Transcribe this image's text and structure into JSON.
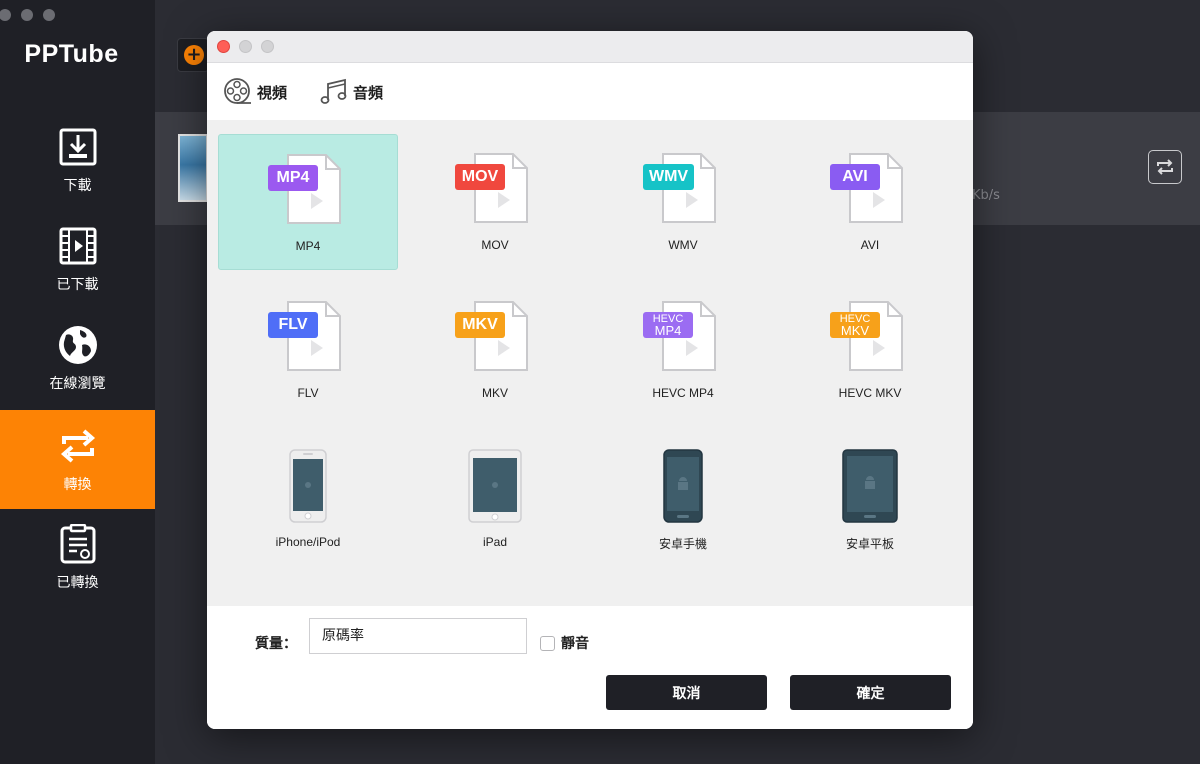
{
  "app": {
    "title": "PPTube"
  },
  "sidebar": {
    "items": [
      {
        "label": "下載",
        "icon": "download-icon"
      },
      {
        "label": "已下載",
        "icon": "film-icon"
      },
      {
        "label": "在線瀏覽",
        "icon": "globe-icon"
      },
      {
        "label": "轉換",
        "icon": "convert-icon",
        "active": true
      },
      {
        "label": "已轉換",
        "icon": "converted-list-icon"
      }
    ],
    "active_color": "#fd8305"
  },
  "background": {
    "speed_fragment": "Kb/s"
  },
  "dialog": {
    "tabs": [
      {
        "label": "視頻",
        "icon": "film-reel-icon",
        "active": true
      },
      {
        "label": "音頻",
        "icon": "music-note-icon"
      }
    ],
    "formats": [
      {
        "label": "MP4",
        "badge": "MP4",
        "badge_color": "#9b59f0",
        "selected": true
      },
      {
        "label": "MOV",
        "badge": "MOV",
        "badge_color": "#f0483e"
      },
      {
        "label": "WMV",
        "badge": "WMV",
        "badge_color": "#16c3c7"
      },
      {
        "label": "AVI",
        "badge": "AVI",
        "badge_color": "#8a5cf2"
      },
      {
        "label": "FLV",
        "badge": "FLV",
        "badge_color": "#4f6ef7"
      },
      {
        "label": "MKV",
        "badge": "MKV",
        "badge_color": "#f7a11a"
      },
      {
        "label": "HEVC MP4",
        "badge_line1": "HEVC",
        "badge_line2": "MP4",
        "badge_color": "#9b6cf2"
      },
      {
        "label": "HEVC MKV",
        "badge_line1": "HEVC",
        "badge_line2": "MKV",
        "badge_color": "#f7a11a"
      },
      {
        "label": "iPhone/iPod",
        "device": "iphone-icon"
      },
      {
        "label": "iPad",
        "device": "ipad-icon"
      },
      {
        "label": "安卓手機",
        "device": "android-phone-icon"
      },
      {
        "label": "安卓平板",
        "device": "android-tablet-icon"
      }
    ],
    "quality_label": "質量：",
    "quality_value": "原碼率",
    "mute_label": "靜音",
    "cancel_label": "取消",
    "confirm_label": "確定"
  }
}
